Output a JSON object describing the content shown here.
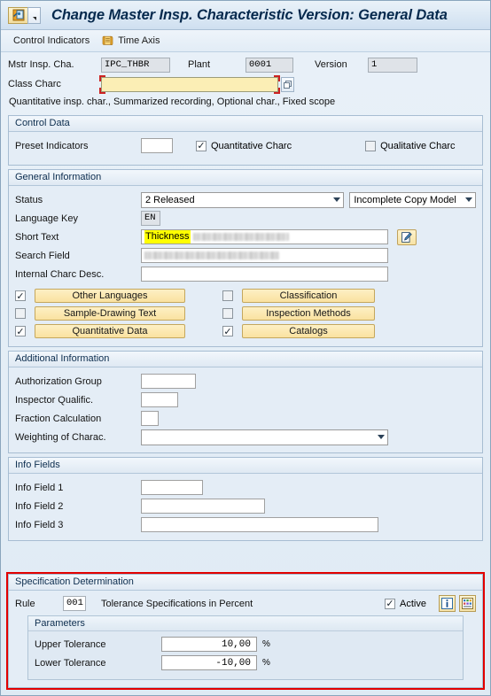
{
  "window": {
    "title": "Change Master Insp. Characteristic Version: General Data",
    "icon": "sap-characteristic-icon",
    "dropdown_icon": "chevron-down-icon"
  },
  "menubar": {
    "items": [
      {
        "label": "Control Indicators",
        "icon": null
      },
      {
        "label": "Time Axis",
        "icon": "scroll-icon"
      }
    ]
  },
  "header": {
    "mstr_insp_cha": {
      "label": "Mstr Insp. Cha.",
      "value": "IPC_THBR"
    },
    "plant": {
      "label": "Plant",
      "value": "0001"
    },
    "version": {
      "label": "Version",
      "value": "1"
    },
    "class_charc": {
      "label": "Class Charc",
      "value": "",
      "lookup_icon": "value-help-icon"
    },
    "summary_line": "Quantitative insp. char., Summarized recording, Optional char., Fixed scope"
  },
  "control_data": {
    "title": "Control Data",
    "preset_indicators": {
      "label": "Preset Indicators",
      "value": ""
    },
    "quantitative_charc": {
      "label": "Quantitative Charc",
      "checked": true
    },
    "qualitative_charc": {
      "label": "Qualitative Charc",
      "checked": false
    }
  },
  "general_information": {
    "title": "General Information",
    "status": {
      "label": "Status",
      "value": "2 Released"
    },
    "copy_model": {
      "value": "Incomplete Copy Model"
    },
    "language_key": {
      "label": "Language Key",
      "value": "EN"
    },
    "short_text": {
      "label": "Short Text",
      "highlight": "Thickness",
      "edit_icon": "edit-text-icon"
    },
    "search_field": {
      "label": "Search Field"
    },
    "internal_charc_desc": {
      "label": "Internal Charc Desc.",
      "value": ""
    },
    "toggles": [
      {
        "label": "Other Languages",
        "checked": true
      },
      {
        "label": "Sample-Drawing Text",
        "checked": false
      },
      {
        "label": "Quantitative Data",
        "checked": true
      },
      {
        "label": "Classification",
        "checked": false
      },
      {
        "label": "Inspection Methods",
        "checked": false
      },
      {
        "label": "Catalogs",
        "checked": true
      }
    ]
  },
  "additional_information": {
    "title": "Additional Information",
    "authorization_group": {
      "label": "Authorization Group",
      "value": ""
    },
    "inspector_qualific": {
      "label": "Inspector Qualific.",
      "value": ""
    },
    "fraction_calculation": {
      "label": "Fraction Calculation",
      "value": ""
    },
    "weighting_of_charac": {
      "label": "Weighting of Charac.",
      "value": ""
    }
  },
  "info_fields": {
    "title": "Info Fields",
    "field1": {
      "label": "Info Field 1",
      "value": ""
    },
    "field2": {
      "label": "Info Field 2",
      "value": ""
    },
    "field3": {
      "label": "Info Field 3",
      "value": ""
    }
  },
  "specification_determination": {
    "title": "Specification Determination",
    "rule": {
      "label": "Rule",
      "value": "001"
    },
    "rule_description": "Tolerance Specifications in Percent",
    "active": {
      "label": "Active",
      "checked": true
    },
    "info_icon": "info-icon",
    "table_icon": "rule-table-icon",
    "parameters": {
      "title": "Parameters",
      "rows": [
        {
          "label": "Upper Tolerance",
          "value": "10,00",
          "unit": "%"
        },
        {
          "label": "Lower Tolerance",
          "value": "-10,00",
          "unit": "%"
        }
      ]
    },
    "highlight_color": "#e20000"
  }
}
